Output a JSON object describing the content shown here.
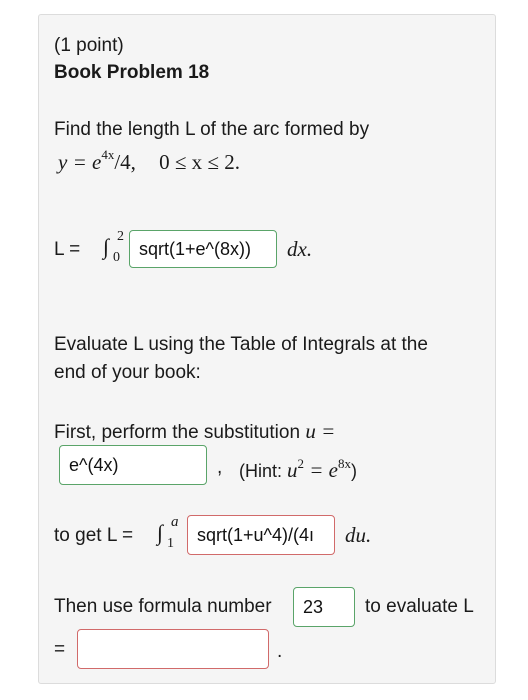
{
  "problem": {
    "points": "(1 point)",
    "title": "Book Problem 18",
    "prompt": "Find the length L of the arc formed by",
    "equation": {
      "lhs": "y = e",
      "exp": "4x",
      "rest": "/4,",
      "range": "0 ≤ x ≤ 2."
    },
    "integral1": {
      "label": "L =",
      "upper": "2",
      "lower": "0",
      "answer_value": "sqrt(1+e^(8x))",
      "tail": "dx."
    },
    "evaluate_line1": "Evaluate L using the Table of Integrals at the",
    "evaluate_line2": "end of your book:",
    "substitution": {
      "text": "First, perform the substitution",
      "var": "u =",
      "answer_value": "e^(4x)",
      "comma": ",",
      "hint_prefix": "(Hint: ",
      "hint_u": "u",
      "hint_pow": "2",
      "hint_eq": " = e",
      "hint_exp": "8x",
      "hint_suffix": ")"
    },
    "integral2": {
      "label": "to get L =",
      "upper": "a",
      "lower": "1",
      "answer_value": "sqrt(1+u^4)/(4ı",
      "tail": "du."
    },
    "formula": {
      "text": "Then use formula number",
      "answer_value": "23",
      "tail": "to evaluate L"
    },
    "final": {
      "eq": "=",
      "answer_value": "",
      "period": "."
    }
  }
}
